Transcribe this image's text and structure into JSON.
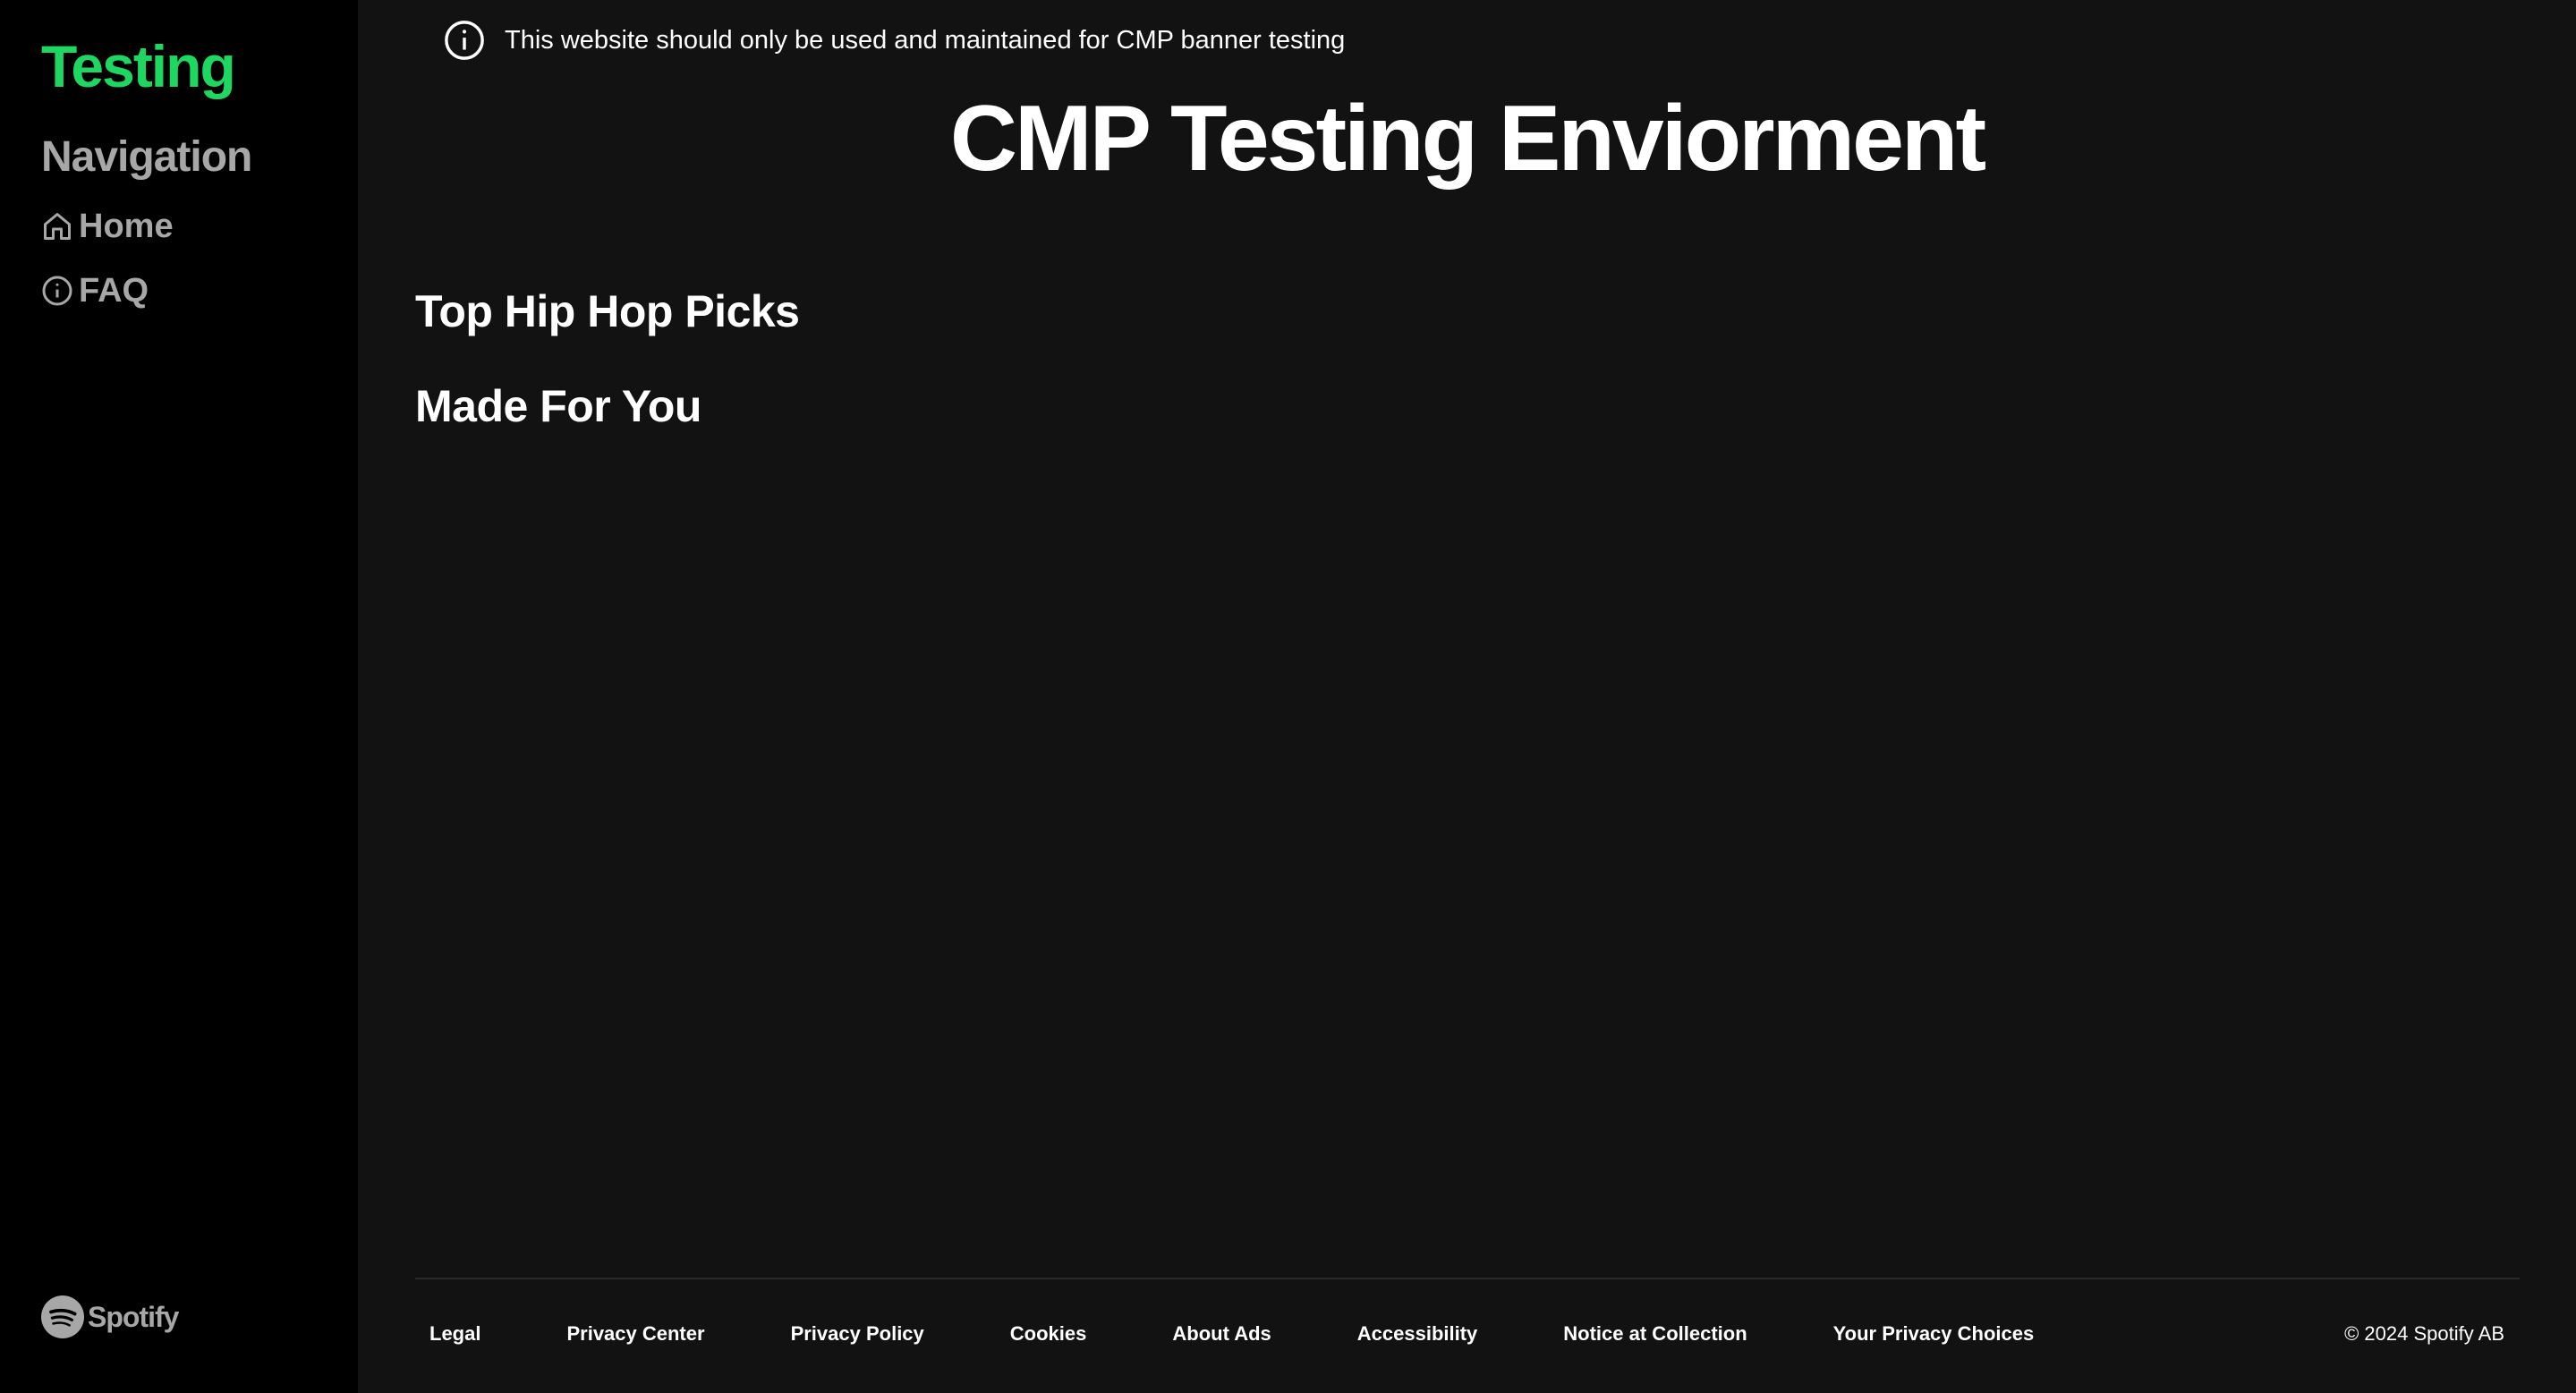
{
  "sidebar": {
    "brand": "Testing",
    "nav_heading": "Navigation",
    "items": [
      {
        "label": "Home",
        "icon": "home-icon"
      },
      {
        "label": "FAQ",
        "icon": "info-icon"
      }
    ],
    "logo_text": "Spotify"
  },
  "main": {
    "notice": "This website should only be used and maintained for CMP banner testing",
    "title": "CMP Testing Enviorment",
    "sections": [
      {
        "title": "Top Hip Hop Picks"
      },
      {
        "title": "Made For You"
      }
    ]
  },
  "footer": {
    "links": [
      "Legal",
      "Privacy Center",
      "Privacy Policy",
      "Cookies",
      "About Ads",
      "Accessibility",
      "Notice at Collection",
      "Your Privacy Choices"
    ],
    "copyright": "© 2024 Spotify AB"
  },
  "colors": {
    "brand_green": "#1ed760",
    "sidebar_bg": "#000000",
    "main_bg": "#121212",
    "muted_text": "#a7a7a7",
    "text": "#ffffff"
  }
}
